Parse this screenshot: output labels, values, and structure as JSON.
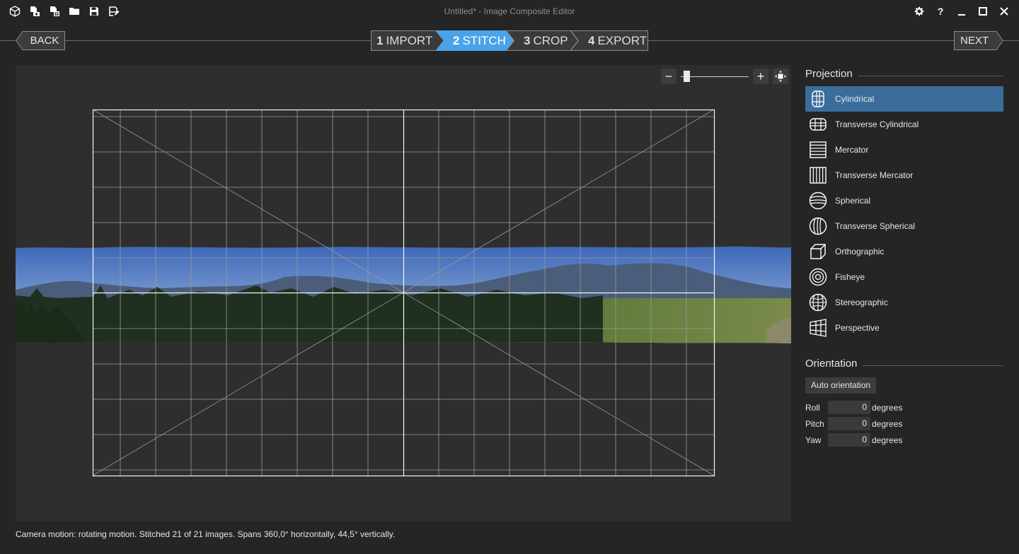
{
  "window": {
    "title": "Untitled* - Image Composite Editor",
    "toolbar_icons": [
      "new-panorama-icon",
      "new-from-video-icon",
      "new-from-images-icon",
      "open-folder-icon",
      "save-icon",
      "save-as-icon"
    ],
    "controls": [
      "gear-icon",
      "help-icon",
      "minimize-icon",
      "maximize-icon",
      "close-icon"
    ],
    "help_label": "?"
  },
  "wizard": {
    "back_label": "BACK",
    "next_label": "NEXT",
    "steps": [
      {
        "num": "1",
        "label": "IMPORT",
        "active": false
      },
      {
        "num": "2",
        "label": "STITCH",
        "active": true
      },
      {
        "num": "3",
        "label": "CROP",
        "active": false
      },
      {
        "num": "4",
        "label": "EXPORT",
        "active": false
      }
    ]
  },
  "zoom": {
    "minus_label": "−",
    "plus_label": "+",
    "level": 0.05
  },
  "projection": {
    "title": "Projection",
    "items": [
      {
        "label": "Cylindrical",
        "icon": "cylindrical-icon",
        "selected": true
      },
      {
        "label": "Transverse Cylindrical",
        "icon": "transverse-cylindrical-icon",
        "selected": false
      },
      {
        "label": "Mercator",
        "icon": "mercator-icon",
        "selected": false
      },
      {
        "label": "Transverse Mercator",
        "icon": "transverse-mercator-icon",
        "selected": false
      },
      {
        "label": "Spherical",
        "icon": "spherical-icon",
        "selected": false
      },
      {
        "label": "Transverse Spherical",
        "icon": "transverse-spherical-icon",
        "selected": false
      },
      {
        "label": "Orthographic",
        "icon": "orthographic-icon",
        "selected": false
      },
      {
        "label": "Fisheye",
        "icon": "fisheye-icon",
        "selected": false
      },
      {
        "label": "Stereographic",
        "icon": "stereographic-icon",
        "selected": false
      },
      {
        "label": "Perspective",
        "icon": "perspective-icon",
        "selected": false
      }
    ]
  },
  "orientation": {
    "title": "Orientation",
    "auto_label": "Auto orientation",
    "fields": [
      {
        "name": "Roll",
        "value": "0",
        "unit": "degrees"
      },
      {
        "name": "Pitch",
        "value": "0",
        "unit": "degrees"
      },
      {
        "name": "Yaw",
        "value": "0",
        "unit": "degrees"
      }
    ]
  },
  "status": "Camera motion: rotating motion. Stitched 21 of 21 images. Spans 360,0° horizontally, 44,5° vertically.",
  "colors": {
    "accent": "#4aa3e8",
    "selected_row": "#3a6d9b",
    "background": "#252526",
    "canvas": "#2e2e2e"
  }
}
